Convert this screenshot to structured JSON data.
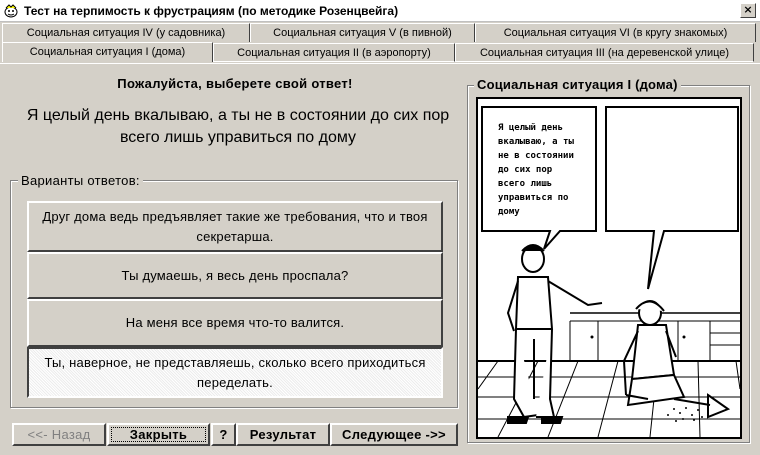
{
  "window": {
    "title": "Тест на терпимость к фрустрациям (по методике Розенцвейга)",
    "close_label": "×"
  },
  "tabs": {
    "row1": [
      "Социальная ситуация IV (у садовника)",
      "Социальная ситуация V (в пивной)",
      "Социальная ситуация VI (в кругу знакомых)"
    ],
    "row2": [
      "Социальная ситуация I (дома)",
      "Социальная ситуация II (в аэропорту)",
      "Социальная ситуация III (на деревенской улице)"
    ],
    "active": "Социальная ситуация I (дома)"
  },
  "prompt": {
    "title": "Пожалуйста, выберете свой ответ!",
    "question": "Я целый день вкалываю, а ты не в состоянии до сих пор всего лишь управиться по дому"
  },
  "answers": {
    "legend": "Варианты ответов:",
    "items": [
      {
        "text": "Друг дома ведь предъявляет такие же требования, что и твоя секретарша.",
        "selected": false
      },
      {
        "text": "Ты думаешь, я весь день проспала?",
        "selected": false
      },
      {
        "text": "На меня все время что-то валится.",
        "selected": false
      },
      {
        "text": "Ты, наверное, не представляешь, сколько всего приходиться переделать.",
        "selected": true
      }
    ]
  },
  "buttons": {
    "back": "<<- Назад",
    "close": "Закрыть",
    "help": "?",
    "result": "Результат",
    "next": "Следующее ->>"
  },
  "picture": {
    "legend": "Социальная ситуация I (дома)",
    "bubble_text": "Я целый день вкалываю, а ты не в состоянии до сих пор всего лишь управиться по дому"
  },
  "colors": {
    "face": "#d4d0c8",
    "shadow": "#404040",
    "highlight": "#ffffff"
  }
}
